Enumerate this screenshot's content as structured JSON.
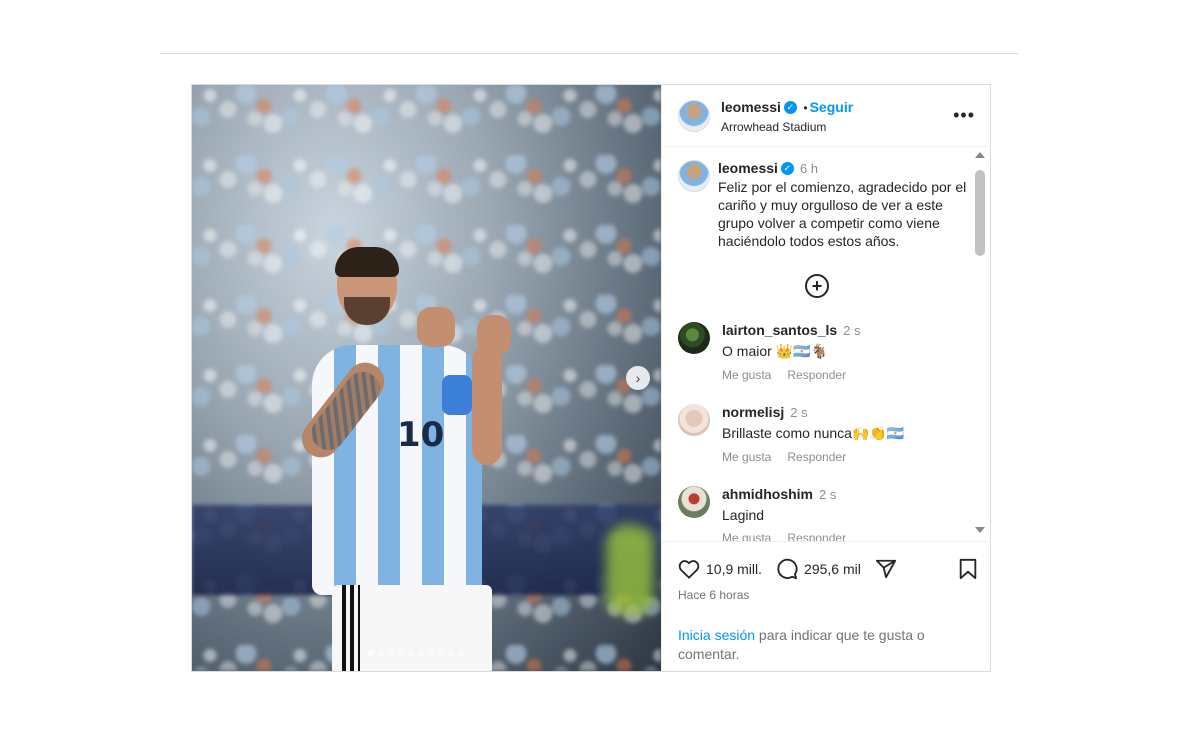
{
  "post": {
    "author": {
      "username": "leomessi",
      "follow_label": "Seguir",
      "separator": "•",
      "location": "Arrowhead Stadium"
    },
    "caption": {
      "username": "leomessi",
      "time": "6 h",
      "text": "Feliz por el comienzo, agradecido por el cariño y muy orgulloso de ver a este grupo volver a competir como viene haciéndolo todos estos años."
    },
    "comments": [
      {
        "username": "lairton_santos_ls",
        "time": "2 s",
        "text": "O maior 👑",
        "extra": "🇦🇷🐐",
        "like_label": "Me gusta",
        "reply_label": "Responder"
      },
      {
        "username": "normelisj",
        "time": "2 s",
        "text": "Brillaste como nunca",
        "extra": "🙌👏🇦🇷",
        "like_label": "Me gusta",
        "reply_label": "Responder"
      },
      {
        "username": "ahmidhoshim",
        "time": "2 s",
        "text": "Lagind",
        "extra": "",
        "like_label": "Me gusta",
        "reply_label": "Responder"
      }
    ],
    "stats": {
      "likes": "10,9 mill.",
      "comments": "295,6 mil"
    },
    "time_ago": "Hace 6 horas",
    "login": {
      "link_text": "Inicia sesión",
      "rest_text": " para indicar que te gusta o comentar."
    },
    "media": {
      "jersey_number": "10",
      "slide_count": 10,
      "active_slide": 0
    }
  },
  "colors": {
    "accent": "#0095f6",
    "text": "#262626",
    "muted": "#8e8e8e"
  },
  "icons": {
    "verified": "verified-badge-icon",
    "more": "more-options-icon",
    "add_comment": "add-circle-icon",
    "like": "heart-icon",
    "comment": "comment-bubble-icon",
    "share": "send-icon",
    "save": "bookmark-icon",
    "next": "chevron-right-icon"
  }
}
